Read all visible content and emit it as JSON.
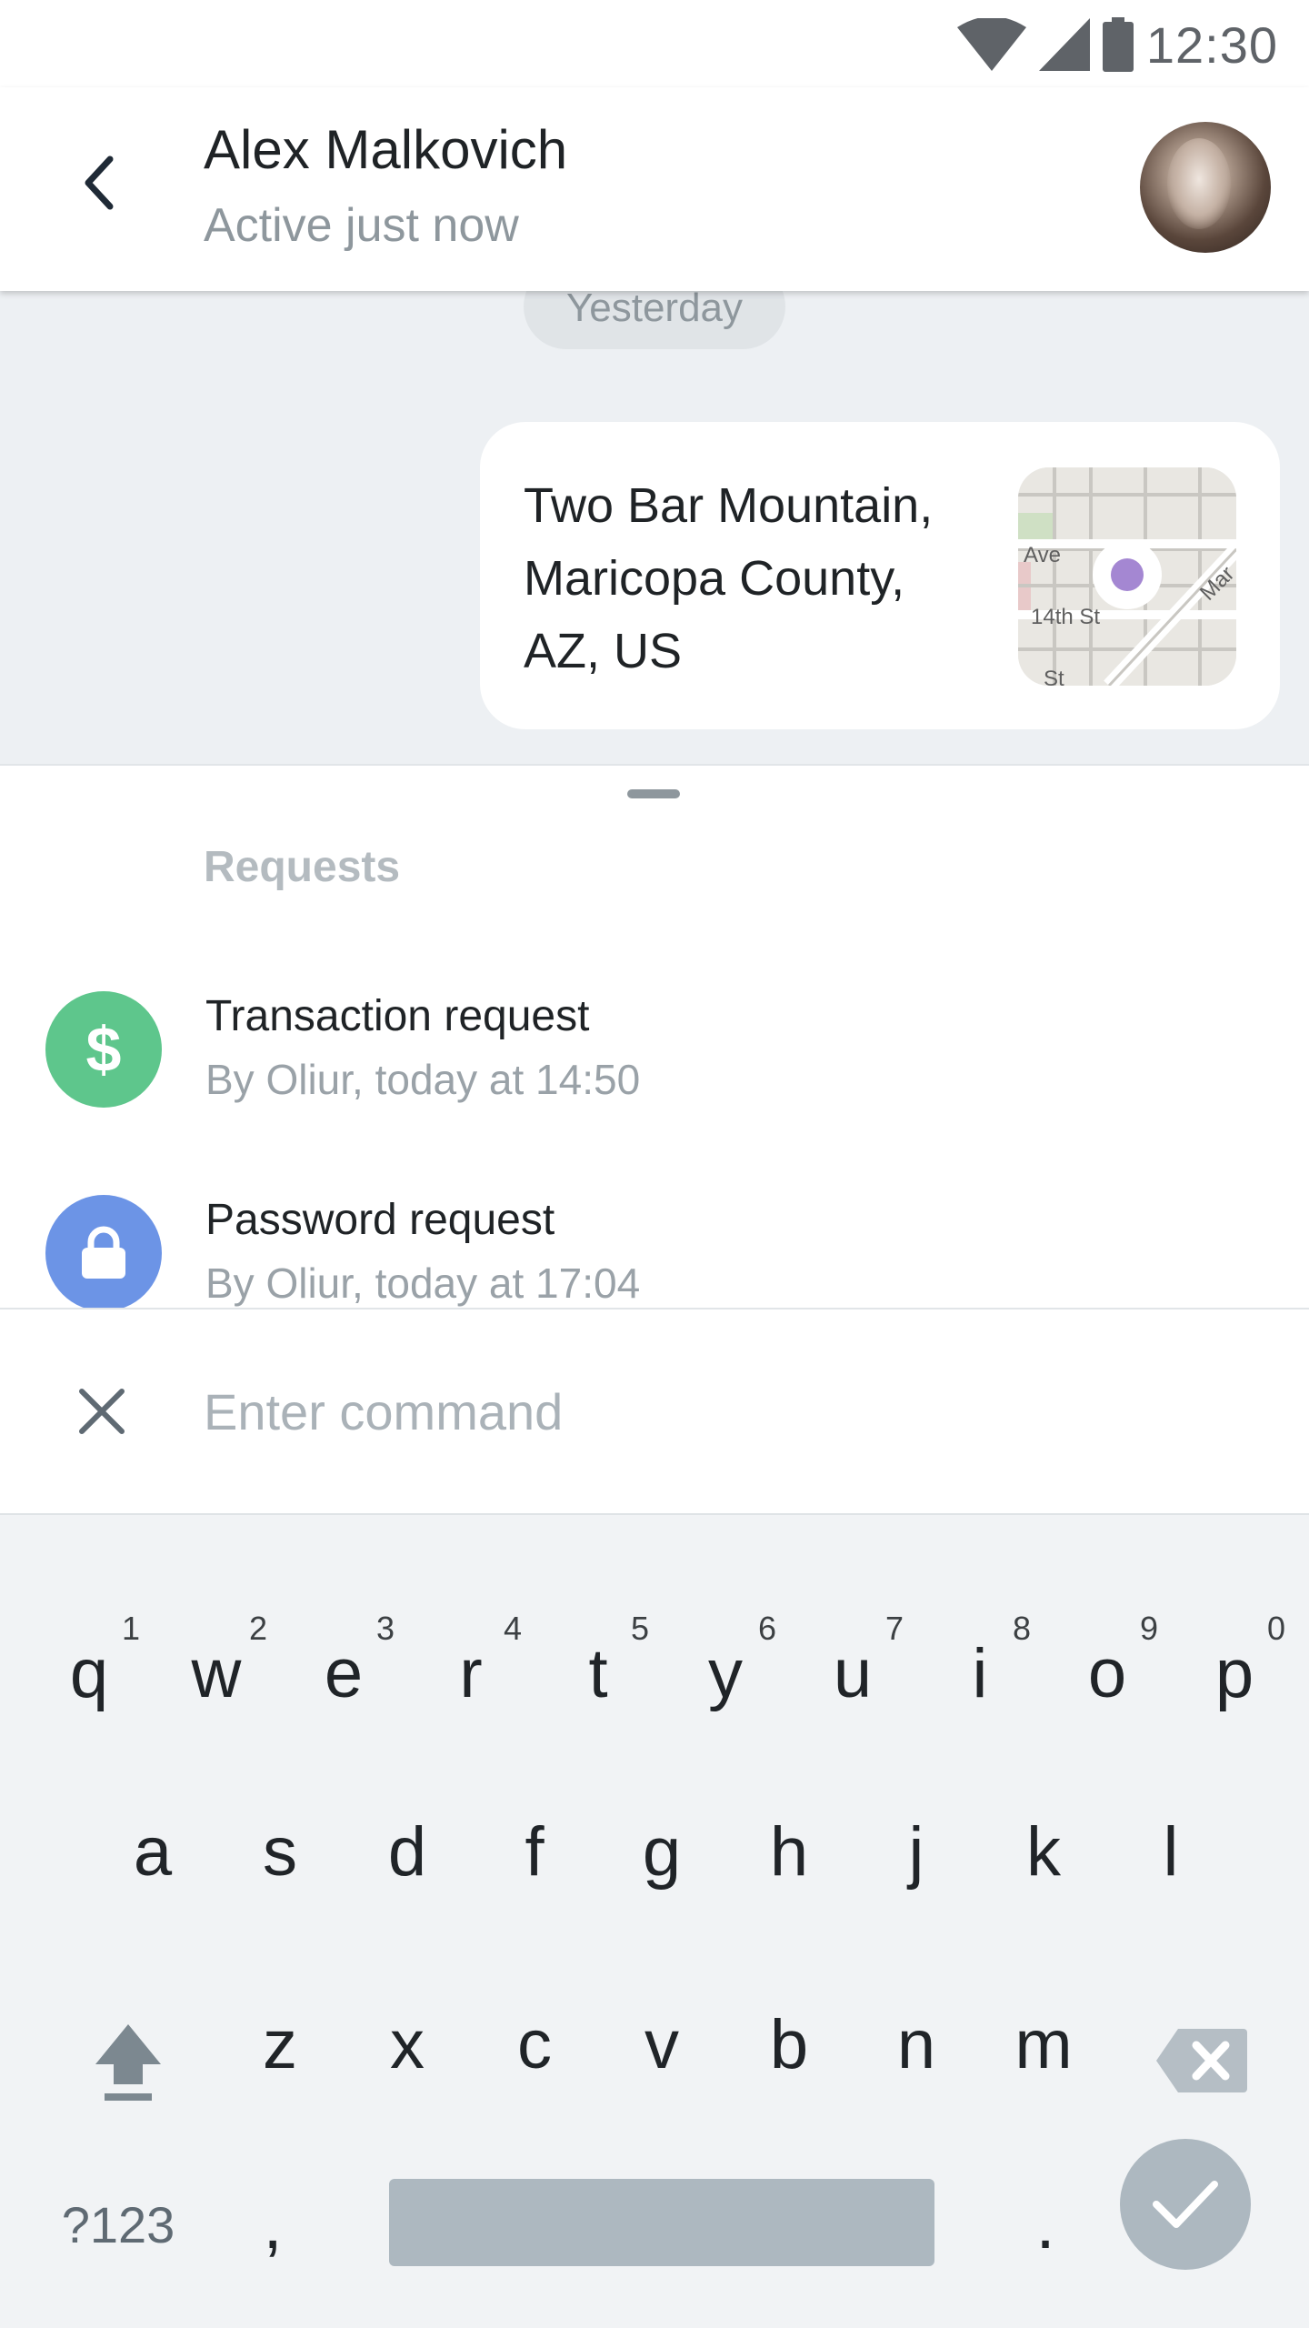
{
  "status_bar": {
    "time": "12:30"
  },
  "header": {
    "contact_name": "Alex Malkovich",
    "contact_status": "Active just now"
  },
  "chat": {
    "date_separator": "Yesterday",
    "location_message": {
      "line1": "Two Bar Mountain,",
      "line2": "Maricopa County,",
      "line3": "AZ, US",
      "map_labels": [
        "Ave",
        "14th St",
        "Mar",
        "St"
      ]
    }
  },
  "requests": {
    "title": "Requests",
    "items": [
      {
        "title": "Transaction request",
        "subtitle": "By Oliur, today at 14:50",
        "icon": "dollar-icon",
        "color": "#5ec68c"
      },
      {
        "title": "Password request",
        "subtitle": "By Oliur, today at 17:04",
        "icon": "lock-icon",
        "color": "#6c94e6"
      }
    ]
  },
  "command": {
    "placeholder": "Enter command"
  },
  "keyboard": {
    "row1": [
      {
        "key": "q",
        "hint": "1"
      },
      {
        "key": "w",
        "hint": "2"
      },
      {
        "key": "e",
        "hint": "3"
      },
      {
        "key": "r",
        "hint": "4"
      },
      {
        "key": "t",
        "hint": "5"
      },
      {
        "key": "y",
        "hint": "6"
      },
      {
        "key": "u",
        "hint": "7"
      },
      {
        "key": "i",
        "hint": "8"
      },
      {
        "key": "o",
        "hint": "9"
      },
      {
        "key": "p",
        "hint": "0"
      }
    ],
    "row2": [
      "a",
      "s",
      "d",
      "f",
      "g",
      "h",
      "j",
      "k",
      "l"
    ],
    "row3": [
      "z",
      "x",
      "c",
      "v",
      "b",
      "n",
      "m"
    ],
    "symbols_label": "?123",
    "comma": ",",
    "period": "."
  },
  "colors": {
    "accent_green": "#5ec68c",
    "accent_blue": "#6c94e6",
    "chat_background": "#edf0f3",
    "keyboard_background": "#f1f3f5",
    "action_key": "#adb8c0"
  }
}
